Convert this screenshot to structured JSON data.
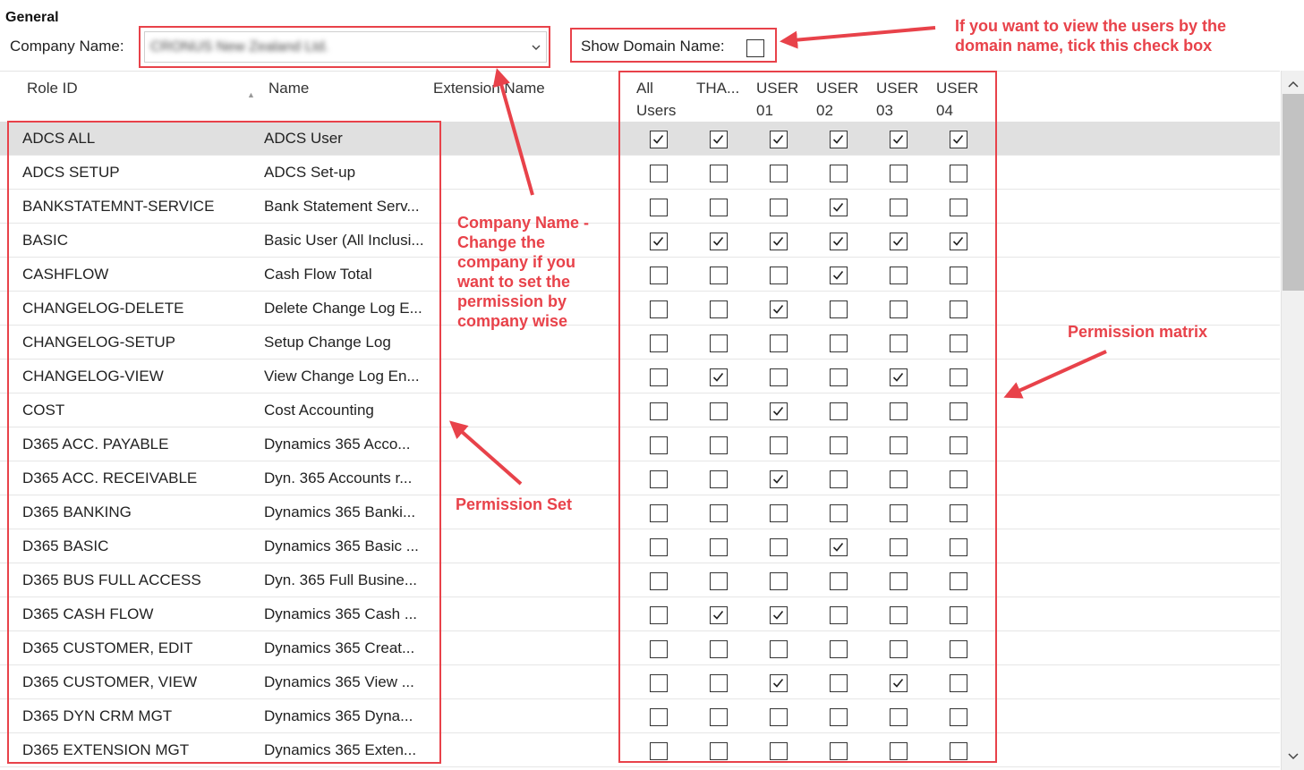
{
  "header": {
    "section_title": "General",
    "company_label": "Company Name:",
    "company_value": "CRONUS New Zealand Ltd.",
    "show_domain_label": "Show Domain Name:",
    "show_domain_checked": false
  },
  "columns": {
    "role_id": "Role ID",
    "name": "Name",
    "extension_name": "Extension Name",
    "users": [
      "All\nUsers",
      "THA...",
      "USER\n01",
      "USER\n02",
      "USER\n03",
      "USER\n04"
    ]
  },
  "rows": [
    {
      "role": "ADCS ALL",
      "name": "ADCS User",
      "selected": true,
      "checks": [
        1,
        1,
        1,
        1,
        1,
        1
      ]
    },
    {
      "role": "ADCS SETUP",
      "name": "ADCS Set-up",
      "checks": [
        0,
        0,
        0,
        0,
        0,
        0
      ]
    },
    {
      "role": "BANKSTATEMNT-SERVICE",
      "name": "Bank Statement Serv...",
      "checks": [
        0,
        0,
        0,
        1,
        0,
        0
      ]
    },
    {
      "role": "BASIC",
      "name": "Basic User (All Inclusi...",
      "checks": [
        1,
        1,
        1,
        1,
        1,
        1
      ]
    },
    {
      "role": "CASHFLOW",
      "name": "Cash Flow Total",
      "checks": [
        0,
        0,
        0,
        1,
        0,
        0
      ]
    },
    {
      "role": "CHANGELOG-DELETE",
      "name": "Delete Change Log E...",
      "checks": [
        0,
        0,
        1,
        0,
        0,
        0
      ]
    },
    {
      "role": "CHANGELOG-SETUP",
      "name": "Setup Change Log",
      "checks": [
        0,
        0,
        0,
        0,
        0,
        0
      ]
    },
    {
      "role": "CHANGELOG-VIEW",
      "name": "View Change Log En...",
      "checks": [
        0,
        1,
        0,
        0,
        1,
        0
      ]
    },
    {
      "role": "COST",
      "name": "Cost Accounting",
      "checks": [
        0,
        0,
        1,
        0,
        0,
        0
      ]
    },
    {
      "role": "D365 ACC. PAYABLE",
      "name": "Dynamics 365 Acco...",
      "checks": [
        0,
        0,
        0,
        0,
        0,
        0
      ]
    },
    {
      "role": "D365 ACC. RECEIVABLE",
      "name": "Dyn. 365 Accounts r...",
      "checks": [
        0,
        0,
        1,
        0,
        0,
        0
      ]
    },
    {
      "role": "D365 BANKING",
      "name": "Dynamics 365 Banki...",
      "checks": [
        0,
        0,
        0,
        0,
        0,
        0
      ]
    },
    {
      "role": "D365 BASIC",
      "name": "Dynamics 365 Basic ...",
      "checks": [
        0,
        0,
        0,
        1,
        0,
        0
      ]
    },
    {
      "role": "D365 BUS FULL ACCESS",
      "name": "Dyn. 365 Full Busine...",
      "checks": [
        0,
        0,
        0,
        0,
        0,
        0
      ]
    },
    {
      "role": "D365 CASH FLOW",
      "name": "Dynamics 365 Cash ...",
      "checks": [
        0,
        1,
        1,
        0,
        0,
        0
      ]
    },
    {
      "role": "D365 CUSTOMER, EDIT",
      "name": "Dynamics 365 Creat...",
      "checks": [
        0,
        0,
        0,
        0,
        0,
        0
      ]
    },
    {
      "role": "D365 CUSTOMER, VIEW",
      "name": "Dynamics 365 View ...",
      "checks": [
        0,
        0,
        1,
        0,
        1,
        0
      ]
    },
    {
      "role": "D365 DYN CRM MGT",
      "name": "Dynamics 365 Dyna...",
      "checks": [
        0,
        0,
        0,
        0,
        0,
        0
      ]
    },
    {
      "role": "D365 EXTENSION MGT",
      "name": "Dynamics 365 Exten...",
      "checks": [
        0,
        0,
        0,
        0,
        0,
        0
      ]
    }
  ],
  "annotations": {
    "domain_note": "If you want to view the users by the domain name, tick this check box",
    "company_note": "Company Name - Change the company if you want to set the permission by company wise",
    "matrix_note": "Permission matrix",
    "set_note": "Permission Set"
  },
  "colors": {
    "annotation": "#e8424a",
    "selected_row": "#e0e0e0"
  }
}
